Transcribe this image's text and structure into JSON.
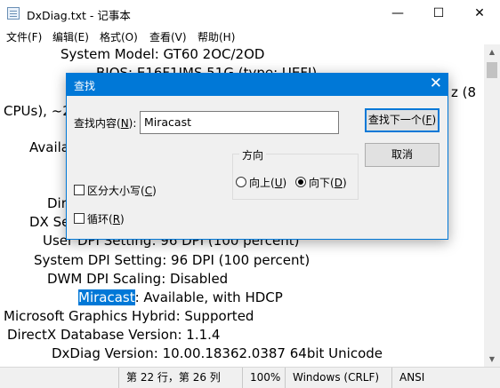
{
  "window": {
    "title": "DxDiag.txt - 记事本",
    "minimize_glyph": "—",
    "maximize_glyph": "☐",
    "close_glyph": "✕"
  },
  "menu": [
    "文件(F)",
    "编辑(E)",
    "格式(O)",
    "查看(V)",
    "帮助(H)"
  ],
  "text_lines": [
    "System Model: GT60 2OC/2OD",
    "BIOS: E16F1IMS.51G (type: UEFI)",
    "z (8",
    "CPUs), ~2",
    "Availa",
    "Dir",
    "DX Se",
    "User DPI Setting: 96 DPI (100 percent)",
    "System DPI Setting: 96 DPI (100 percent)",
    "DWM DPI Scaling: Disabled",
    "Microsoft Graphics Hybrid: Supported",
    "DirectX Database Version: 1.1.4",
    "DxDiag Version: 10.00.18362.0387 64bit Unicode"
  ],
  "miracast_line": {
    "highlight": "Miracast",
    "rest": ": Available, with HDCP"
  },
  "find_dialog": {
    "title": "查找",
    "find_label_pre": "查找内容(",
    "find_label_key": "N",
    "find_label_post": "):",
    "find_value": "Miracast",
    "find_next_pre": "查找下一个(",
    "find_next_key": "F",
    "find_next_post": ")",
    "cancel": "取消",
    "direction_label": "方向",
    "up_pre": "向上(",
    "up_key": "U",
    "up_post": ")",
    "down_pre": "向下(",
    "down_key": "D",
    "down_post": ")",
    "match_case_pre": "区分大小写(",
    "match_case_key": "C",
    "match_case_post": ")",
    "wrap_pre": "循环(",
    "wrap_key": "R",
    "wrap_post": ")",
    "direction_selected": "down",
    "match_case_checked": false,
    "wrap_checked": false,
    "close_glyph": "✕"
  },
  "statusbar": {
    "position": "第 22 行，第 26 列",
    "zoom": "100%",
    "line_ending": "Windows (CRLF)",
    "encoding": "ANSI"
  },
  "colors": {
    "accent": "#0078d7",
    "selection": "#0078d7"
  }
}
